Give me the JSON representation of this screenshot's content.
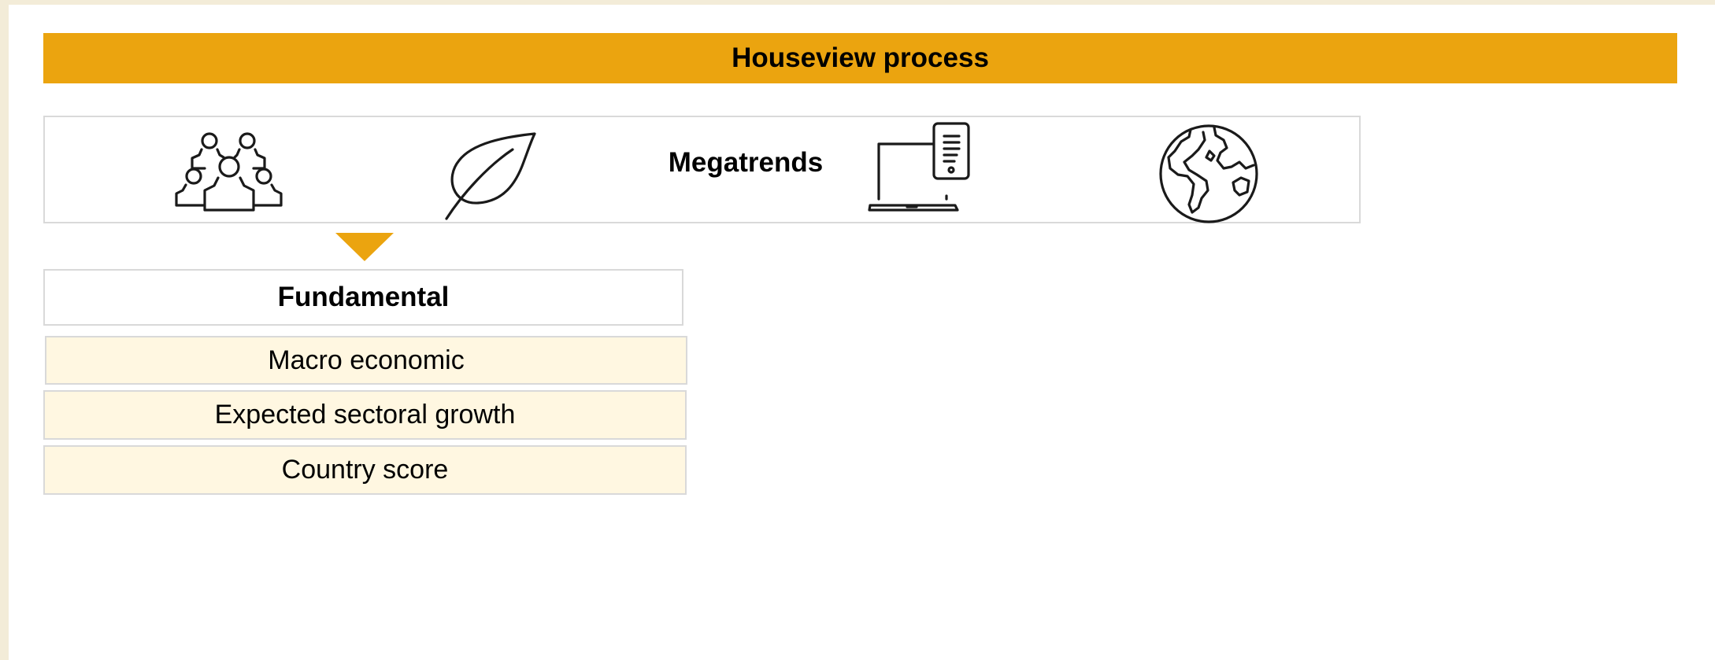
{
  "header": {
    "title": "Houseview process",
    "color": "#eba40f"
  },
  "megatrends": {
    "label": "Megatrends",
    "icons": [
      "people-group-icon",
      "leaf-icon",
      "laptop-phone-icon",
      "globe-icon"
    ]
  },
  "fundamental": {
    "title": "Fundamental",
    "items": [
      "Macro economic",
      "Expected sectoral growth",
      "Country score"
    ]
  },
  "colors": {
    "accent": "#eba40f",
    "item_fill": "#fff7e1",
    "border": "#d9d9d9",
    "page_background": "#f3ecd8"
  }
}
